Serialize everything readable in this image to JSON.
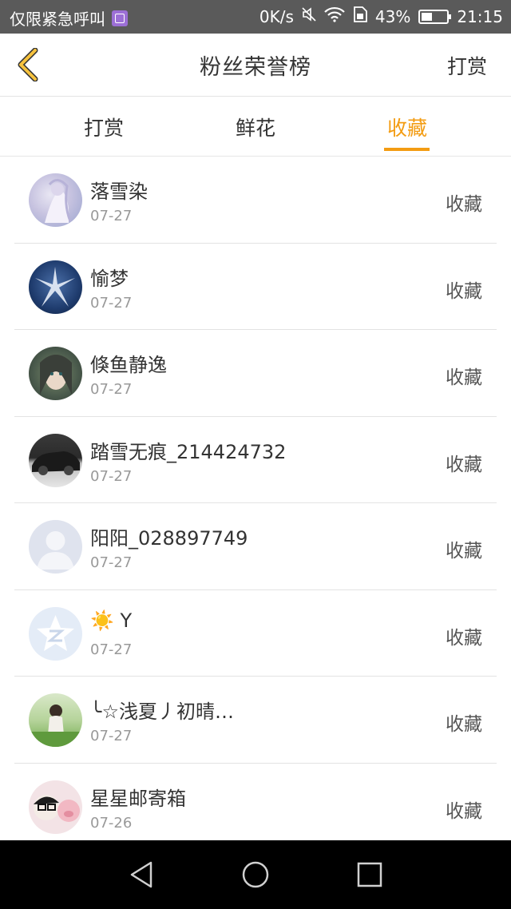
{
  "status_bar": {
    "left_text": "仅限紧急呼叫",
    "speed": "0K/s",
    "battery_percent": "43%",
    "battery_level": 0.43,
    "time": "21:15"
  },
  "header": {
    "title": "粉丝荣誉榜",
    "action_label": "打赏"
  },
  "tabs": [
    {
      "label": "打赏",
      "active": false
    },
    {
      "label": "鲜花",
      "active": false
    },
    {
      "label": "收藏",
      "active": true
    }
  ],
  "items": [
    {
      "name": "落雪染",
      "date": "07-27",
      "badge": "收藏"
    },
    {
      "name": "愉梦",
      "date": "07-27",
      "badge": "收藏"
    },
    {
      "name": "倏鱼静逸",
      "date": "07-27",
      "badge": "收藏"
    },
    {
      "name": "踏雪无痕_214424732",
      "date": "07-27",
      "badge": "收藏"
    },
    {
      "name": "阳阳_028897749",
      "date": "07-27",
      "badge": "收藏"
    },
    {
      "name": "☀️ Y",
      "date": "07-27",
      "badge": "收藏"
    },
    {
      "name": "╰☆浅夏丿初晴…",
      "date": "07-27",
      "badge": "收藏"
    },
    {
      "name": "星星邮寄箱",
      "date": "07-26",
      "badge": "收藏"
    }
  ],
  "colors": {
    "accent": "#f39c12",
    "status_bar_bg": "#5a5a5a",
    "nav_bar_bg": "#000000"
  }
}
